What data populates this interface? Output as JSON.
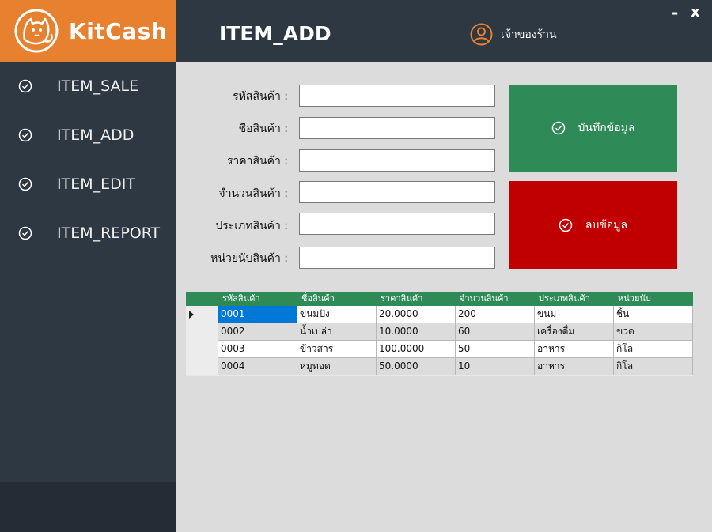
{
  "brand": {
    "name": "KitCash",
    "color": "#e8812f"
  },
  "header": {
    "title": "ITEM_ADD",
    "user": "เจ้าของร้าน",
    "minimize": "-",
    "close": "x"
  },
  "sidebar": {
    "items": [
      {
        "label": "ITEM_SALE",
        "icon": "check-circle-icon"
      },
      {
        "label": "ITEM_ADD",
        "icon": "check-circle-icon"
      },
      {
        "label": "ITEM_EDIT",
        "icon": "check-circle-icon"
      },
      {
        "label": "ITEM_REPORT",
        "icon": "check-circle-icon"
      }
    ]
  },
  "form": {
    "fields": [
      {
        "label": "รหัสสินค้า :",
        "value": ""
      },
      {
        "label": "ชื่อสินค้า :",
        "value": ""
      },
      {
        "label": "ราคาสินค้า :",
        "value": ""
      },
      {
        "label": "จำนวนสินค้า :",
        "value": ""
      },
      {
        "label": "ประเภทสินค้า :",
        "value": ""
      },
      {
        "label": "หน่วยนับสินค้า :",
        "value": ""
      }
    ],
    "save_label": "บันทึกข้อมูล",
    "delete_label": "ลบข้อมูล",
    "save_color": "#2e8b57",
    "delete_color": "#c00000"
  },
  "grid": {
    "columns": [
      "รหัสสินค้า",
      "ชื่อสินค้า",
      "ราคาสินค้า",
      "จำนวนสินค้า",
      "ประเภทสินค้า",
      "หน่วยนับ"
    ],
    "rows": [
      [
        "0001",
        "ขนมปัง",
        "20.0000",
        "200",
        "ขนม",
        "ชิ้น"
      ],
      [
        "0002",
        "น้ำเปล่า",
        "10.0000",
        "60",
        "เครื่องดื่ม",
        "ขวด"
      ],
      [
        "0003",
        "ข้าวสาร",
        "100.0000",
        "50",
        "อาหาร",
        "กิโล"
      ],
      [
        "0004",
        "หมูทอด",
        "50.0000",
        "10",
        "อาหาร",
        "กิโล"
      ]
    ]
  }
}
